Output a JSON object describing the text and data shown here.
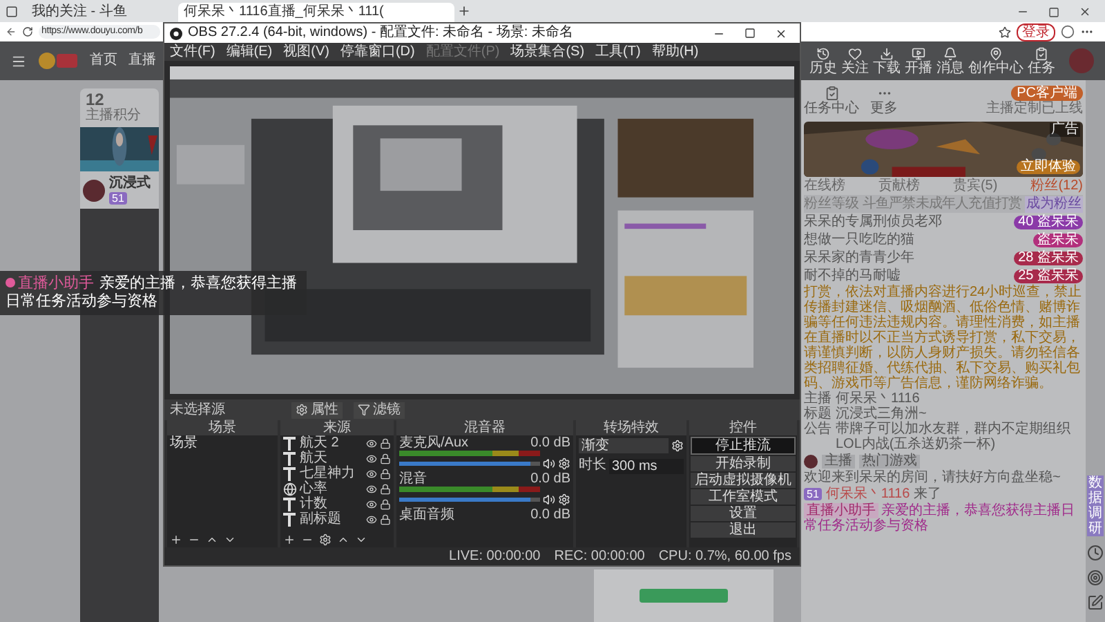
{
  "browser": {
    "tabs": [
      {
        "title": "我的关注 - 斗鱼",
        "selected": false
      },
      {
        "title": "何呆呆丶1116直播_何呆呆丶111(",
        "selected": true
      }
    ],
    "url": "https://www.douyu.com/b",
    "login": "登录"
  },
  "site": {
    "nav": [
      "首页",
      "直播"
    ],
    "header_icons": [
      "历史",
      "关注",
      "下载",
      "开播",
      "消息",
      "创作中心",
      "任务"
    ],
    "score": "12",
    "score_label": "主播积分",
    "streamer_name": "沉浸式",
    "level_badge": "51"
  },
  "toast": {
    "sender": "直播小助手",
    "text": "亲爱的主播，恭喜您获得主播日常任务活动参与资格"
  },
  "obs": {
    "title": "OBS 27.2.4 (64-bit, windows) - 配置文件: 未命名 - 场景: 未命名",
    "menu": [
      {
        "label": "文件(F)",
        "disabled": false
      },
      {
        "label": "编辑(E)",
        "disabled": false
      },
      {
        "label": "视图(V)",
        "disabled": false
      },
      {
        "label": "停靠窗口(D)",
        "disabled": false
      },
      {
        "label": "配置文件(P)",
        "disabled": true
      },
      {
        "label": "场景集合(S)",
        "disabled": false
      },
      {
        "label": "工具(T)",
        "disabled": false
      },
      {
        "label": "帮助(H)",
        "disabled": false
      }
    ],
    "source_bar": {
      "label": "未选择源",
      "buttons": [
        "属性",
        "滤镜"
      ]
    },
    "docks": [
      "场景",
      "来源",
      "混音器",
      "转场特效",
      "控件"
    ],
    "scenes": [
      "场景"
    ],
    "sources": [
      {
        "name": "航天 2",
        "kind": "text"
      },
      {
        "name": "航天",
        "kind": "text"
      },
      {
        "name": "七星神力",
        "kind": "text"
      },
      {
        "name": "心率",
        "kind": "browser"
      },
      {
        "name": "计数",
        "kind": "text"
      },
      {
        "name": "副标题",
        "kind": "text"
      }
    ],
    "mixer": [
      {
        "name": "麦克风/Aux",
        "reading": "0.0 dB",
        "level": 0.93
      },
      {
        "name": "混音",
        "reading": "0.0 dB",
        "level": 0.93
      },
      {
        "name": "桌面音频",
        "reading": "0.0 dB"
      }
    ],
    "transition": {
      "type": "渐变",
      "duration_label": "时长",
      "duration": "300 ms"
    },
    "controls": [
      {
        "label": "停止推流",
        "highlighted": true
      },
      {
        "label": "开始录制",
        "highlighted": false
      },
      {
        "label": "启动虚拟摄像机",
        "highlighted": false
      },
      {
        "label": "工作室模式",
        "highlighted": false
      },
      {
        "label": "设置",
        "highlighted": false
      },
      {
        "label": "退出",
        "highlighted": false
      }
    ],
    "status": {
      "live": "LIVE: 00:00:00",
      "rec": "REC: 00:00:00",
      "cpu": "CPU: 0.7%, 60.00 fps"
    }
  },
  "panel": {
    "quick": [
      "任务中心",
      "更多"
    ],
    "client_button": "PC客户端",
    "client_note": "主播定制已上线",
    "ad": {
      "tag": "广告",
      "button": "立即体验"
    },
    "tabs": [
      {
        "label": "在线榜",
        "selected": false
      },
      {
        "label": "贡献榜",
        "selected": false
      },
      {
        "label": "贵宾(5)",
        "selected": false
      },
      {
        "label": "粉丝(12)",
        "selected": true
      }
    ],
    "fan_bar": {
      "label": "粉丝等级",
      "notice": "斗鱼严禁未成年人充值打赏",
      "join": "成为粉丝"
    },
    "fans": [
      {
        "name": "呆呆的专属刑侦员老邓",
        "level": "40",
        "badge": "盗呆呆",
        "color": "#8b3aa8"
      },
      {
        "name": "想做一只吃吃的猫",
        "badge": "盗呆呆",
        "color": "#b2307c"
      },
      {
        "name": "呆呆家的青青少年",
        "level": "28",
        "badge": "盗呆呆",
        "color": "#a82a4c"
      },
      {
        "name": "耐不掉的马耐嘘",
        "level": "25",
        "badge": "盗呆呆",
        "color": "#a82a4c"
      }
    ],
    "notice": "打赏，依法对直播内容进行24小时巡查，禁止传播封建迷信、吸烟酗酒、低俗色情、赌博诈骗等任何违法违规内容。请理性消费，如主播在直播时以不正当方式诱导打赏，私下交易，请谨慎判断，以防人身财产损失。请勿轻信各类招聘征婚、代练代抽、私下交易、购买礼包码、游戏币等广告信息，谨防网络诈骗。",
    "info": [
      {
        "label": "主播",
        "value": "何呆呆丶1116"
      },
      {
        "label": "标题",
        "value": "沉浸式三角洲~"
      },
      {
        "label": "公告",
        "value": "带牌子可以加水友群，群内不定期组织LOL内战(五杀送奶茶一杯)"
      }
    ],
    "chat_tags": [
      "主播",
      "热门游戏"
    ],
    "welcome": "欢迎来到呆呆的房间，请扶好方向盘坐稳~",
    "arrival": {
      "badge": "51",
      "name": "何呆呆丶1116",
      "text": "来了"
    },
    "assistant": {
      "sender": "直播小助手",
      "text": "亲爱的主播，恭喜您获得主播日常任务活动参与资格"
    }
  },
  "float": {
    "survey": "数据调研"
  }
}
